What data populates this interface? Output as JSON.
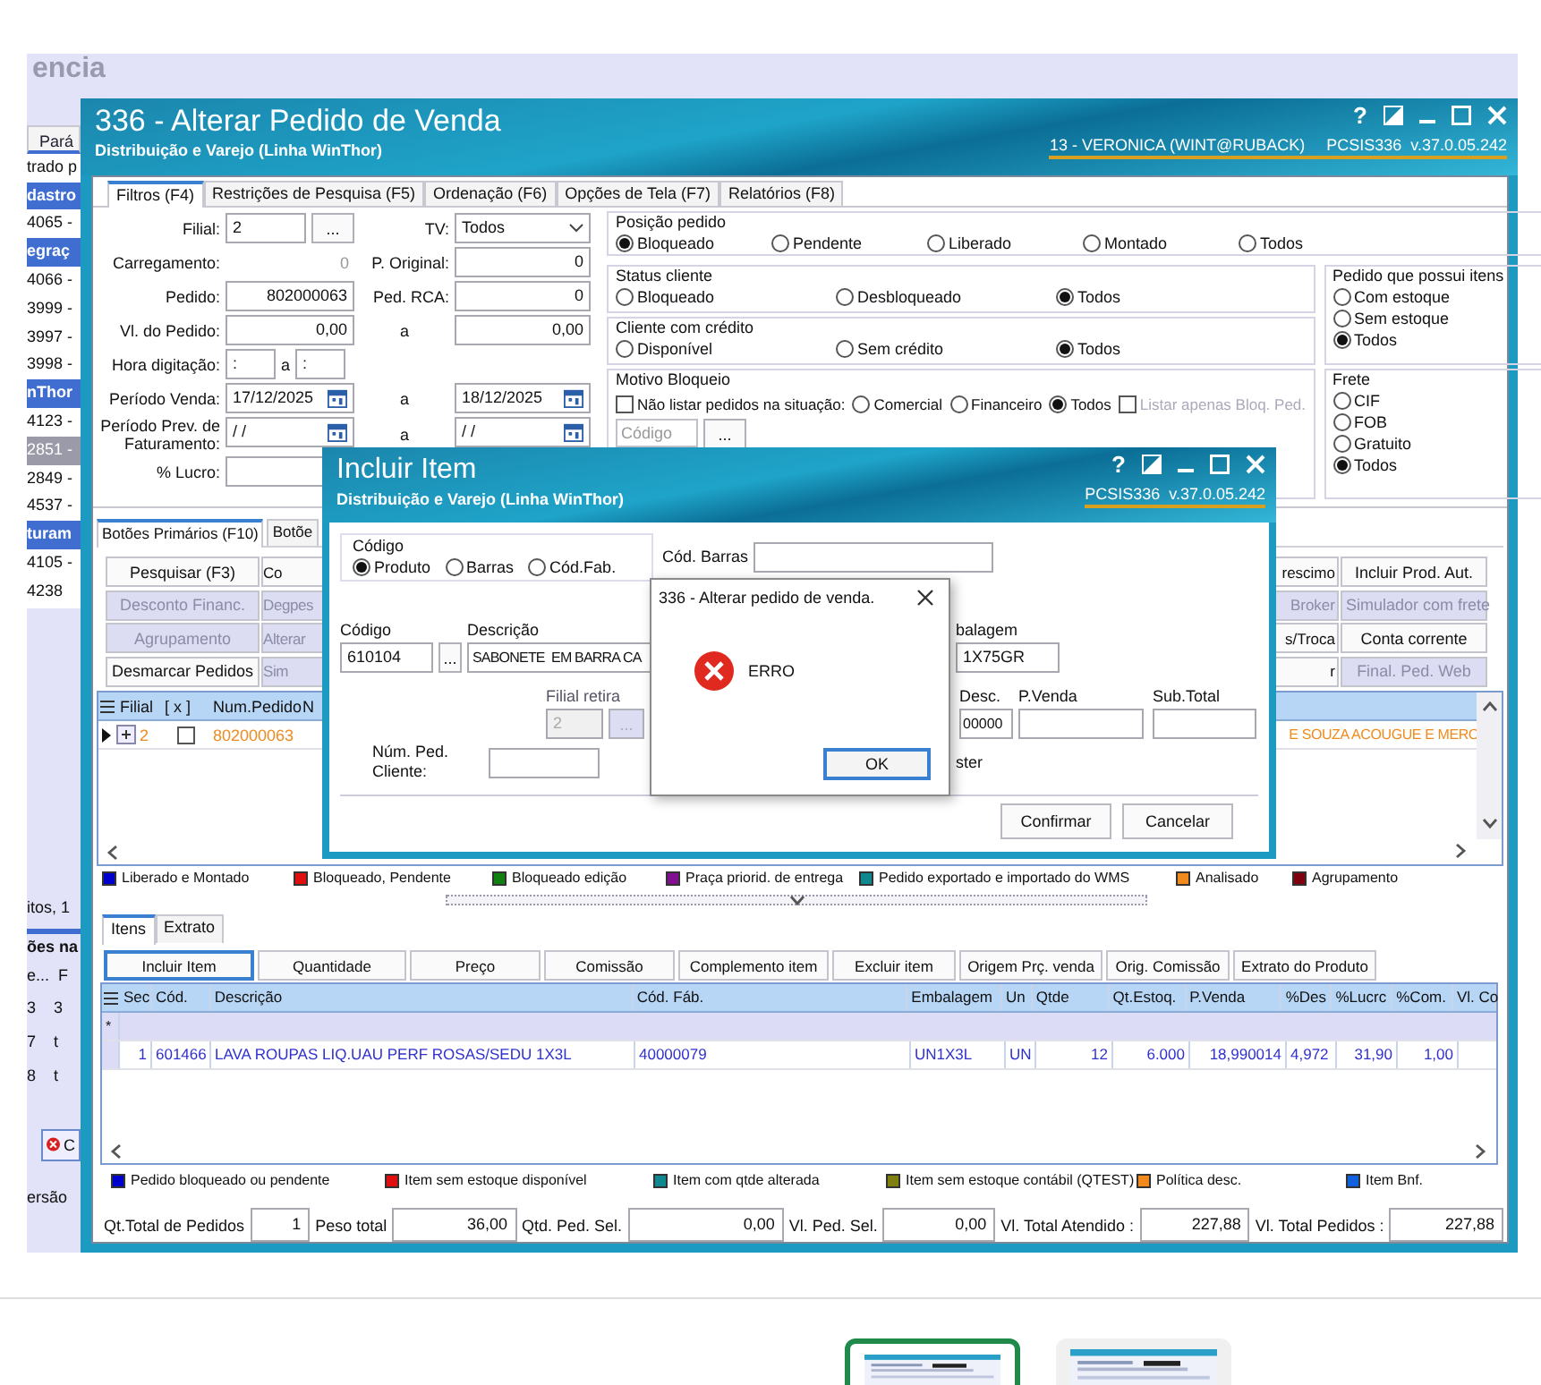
{
  "background_app": {
    "heading": "encia",
    "strip_upper": [
      {
        "text": "Pará",
        "kind": "tab"
      },
      {
        "text": "trado p",
        "kind": "plain"
      },
      {
        "text": "dastro",
        "kind": "section"
      },
      {
        "text": "4065 -",
        "kind": "plain"
      },
      {
        "text": "egraç",
        "kind": "section"
      },
      {
        "text": "4066 -",
        "kind": "plain"
      },
      {
        "text": "3999 -",
        "kind": "plain"
      },
      {
        "text": "3997 -",
        "kind": "plain"
      },
      {
        "text": "3998 -",
        "kind": "plain"
      },
      {
        "text": "nThor",
        "kind": "section"
      },
      {
        "text": "4123 -",
        "kind": "plain"
      },
      {
        "text": "2851 -",
        "kind": "selected"
      },
      {
        "text": "2849 -",
        "kind": "plain"
      },
      {
        "text": "4537 -",
        "kind": "plain"
      },
      {
        "text": "turam",
        "kind": "section"
      },
      {
        "text": "4105 -",
        "kind": "plain"
      },
      {
        "text": "4238",
        "kind": "plain"
      }
    ],
    "strip_lower": [
      {
        "text": "itos, 1",
        "kind": "plain"
      },
      {
        "text": "ões na",
        "kind": "bold"
      },
      {
        "text": "e...  F",
        "kind": "plain"
      },
      {
        "text": "3    3",
        "kind": "plain"
      },
      {
        "text": "7    t",
        "kind": "plain"
      },
      {
        "text": "8    t",
        "kind": "plain"
      },
      {
        "text": "C",
        "kind": "error"
      },
      {
        "text": "ersão",
        "kind": "plain"
      }
    ]
  },
  "main_window": {
    "title": "336 - Alterar Pedido de Venda",
    "subtitle": "Distribuição e Varejo (Linha WinThor)",
    "help_label": "?",
    "user": "13 - VERONICA (WINT@RUBACK)",
    "version": "PCSIS336  v.37.0.05.242",
    "tabs": [
      {
        "label": "Filtros (F4)",
        "selected": true
      },
      {
        "label": "Restrições de Pesquisa (F5)",
        "selected": false
      },
      {
        "label": "Ordenação (F6)",
        "selected": false
      },
      {
        "label": "Opções de Tela (F7)",
        "selected": false
      },
      {
        "label": "Relatórios (F8)",
        "selected": false
      }
    ],
    "form_rows": [
      [
        {
          "kind": "label",
          "text": "Filial:"
        },
        {
          "kind": "lookup",
          "value": "2",
          "lookup_label": "..."
        },
        {
          "kind": "label",
          "text": "TV:"
        },
        {
          "kind": "select",
          "value": "Todos"
        }
      ],
      [
        {
          "kind": "label",
          "text": "Carregamento:"
        },
        {
          "kind": "readout",
          "value": "0"
        },
        {
          "kind": "label",
          "text": "P. Original:"
        },
        {
          "kind": "input",
          "value": "0"
        }
      ],
      [
        {
          "kind": "label",
          "text": "Pedido:"
        },
        {
          "kind": "input",
          "value": "802000063"
        },
        {
          "kind": "label",
          "text": "Ped. RCA:"
        },
        {
          "kind": "input",
          "value": "0"
        }
      ],
      [
        {
          "kind": "label",
          "text": "Vl. do Pedido:"
        },
        {
          "kind": "input",
          "value": "0,00"
        },
        {
          "kind": "connector",
          "text": "a"
        },
        {
          "kind": "input",
          "value": "0,00"
        }
      ],
      [
        {
          "kind": "label",
          "text": "Hora digitação:"
        },
        {
          "kind": "time",
          "from": ":",
          "sep": "a",
          "to": ":"
        }
      ],
      [
        {
          "kind": "label",
          "text": "Período Venda:"
        },
        {
          "kind": "date",
          "value": "17/12/2025"
        },
        {
          "kind": "connector",
          "text": "a"
        },
        {
          "kind": "date",
          "value": "18/12/2025"
        }
      ],
      [
        {
          "kind": "label",
          "text": "Período Prev. de Faturamento:"
        },
        {
          "kind": "date",
          "value": "/ /"
        },
        {
          "kind": "connector",
          "text": "a"
        },
        {
          "kind": "date",
          "value": "/ /"
        }
      ],
      [
        {
          "kind": "label",
          "text": "% Lucro:"
        },
        {
          "kind": "input"
        }
      ]
    ],
    "groups": [
      {
        "title": "Posição pedido",
        "options": [
          {
            "label": "Bloqueado",
            "selected": true
          },
          {
            "label": "Pendente",
            "selected": false
          },
          {
            "label": "Liberado",
            "selected": false
          },
          {
            "label": "Montado",
            "selected": false
          },
          {
            "label": "Todos",
            "selected": false
          }
        ]
      },
      {
        "title": "Status cliente",
        "options": [
          {
            "label": "Bloqueado",
            "selected": false
          },
          {
            "label": "Desbloqueado",
            "selected": false
          },
          {
            "label": "Todos",
            "selected": true
          }
        ]
      },
      {
        "title": "Pedido que possui itens",
        "options": [
          {
            "label": "Com estoque",
            "selected": false
          },
          {
            "label": "Sem estoque",
            "selected": false
          },
          {
            "label": "Todos",
            "selected": true
          }
        ]
      },
      {
        "title": "Cliente com crédito",
        "options": [
          {
            "label": "Disponível",
            "selected": false
          },
          {
            "label": "Sem crédito",
            "selected": false
          },
          {
            "label": "Todos",
            "selected": true
          }
        ]
      },
      {
        "title": "Frete",
        "options": [
          {
            "label": "CIF",
            "selected": false
          },
          {
            "label": "FOB",
            "selected": false
          },
          {
            "label": "Gratuito",
            "selected": false
          },
          {
            "label": "Todos",
            "selected": true
          }
        ]
      }
    ],
    "motivo": {
      "title": "Motivo Bloqueio",
      "checkbox": {
        "label": "Não listar pedidos na situação:",
        "checked": false
      },
      "options": [
        {
          "label": "Comercial",
          "selected": false
        },
        {
          "label": "Financeiro",
          "selected": false
        },
        {
          "label": "Todos",
          "selected": true
        }
      ],
      "secondary_checkbox": {
        "label": "Listar apenas Bloq. Ped.",
        "checked": false,
        "disabled": true
      },
      "code_placeholder": "Código",
      "lookup_label": "..."
    },
    "button_tabs": [
      {
        "label": "Botões Primários (F10)",
        "selected": true
      },
      {
        "label": "Botõe",
        "selected": false
      }
    ],
    "buttons_left": [
      [
        {
          "label": "Pesquisar (F3)",
          "disabled": false
        },
        {
          "label": "Co",
          "disabled": false
        }
      ],
      [
        {
          "label": "Desconto Financ.",
          "disabled": true
        },
        {
          "label": "Degpes",
          "disabled": true
        }
      ],
      [
        {
          "label": "Agrupamento",
          "disabled": true
        },
        {
          "label": "Alterar",
          "disabled": true
        }
      ],
      [
        {
          "label": "Desmarcar Pedidos",
          "disabled": false
        },
        {
          "label": "Sim",
          "disabled": true
        }
      ]
    ],
    "buttons_right": [
      [
        {
          "label": "rescimo",
          "disabled": false
        },
        {
          "label": "Incluir Prod. Aut.",
          "disabled": false
        }
      ],
      [
        {
          "label": "Broker",
          "disabled": true
        },
        {
          "label": "Simulador com frete",
          "disabled": true
        }
      ],
      [
        {
          "label": "s/Troca",
          "disabled": false
        },
        {
          "label": "Conta corrente",
          "disabled": false
        }
      ],
      [
        {
          "label": "r",
          "disabled": false
        },
        {
          "label": "Final. Ped. Web",
          "disabled": true
        }
      ]
    ],
    "orders": {
      "columns": [
        "Filial",
        "[ x ]",
        "Num.Pedido",
        "N"
      ],
      "rows": [
        {
          "filial": "2",
          "checked": false,
          "num_pedido": "802000063",
          "column_5": "E SOUZA ACOUGUE E MERC",
          "color": "#f08a1c"
        }
      ]
    },
    "legend": [
      {
        "label": "Liberado e Montado",
        "color": "#0000cc"
      },
      {
        "label": "Bloqueado, Pendente",
        "color": "#e01010"
      },
      {
        "label": "Bloqueado edição",
        "color": "#108010"
      },
      {
        "label": "Praça priorid. de entrega",
        "color": "#801090"
      },
      {
        "label": "Pedido exportado e importado do WMS",
        "color": "#108890"
      },
      {
        "label": "Analisado",
        "color": "#f08a1c"
      },
      {
        "label": "Agrupamento",
        "color": "#800010"
      }
    ],
    "item_tabs": [
      {
        "label": "Itens",
        "selected": true
      },
      {
        "label": "Extrato",
        "selected": false
      }
    ],
    "item_buttons": [
      "Incluir Item",
      "Quantidade",
      "Preço",
      "Comissão",
      "Complemento item",
      "Excluir item",
      "Origem Prç. venda",
      "Orig. Comissão",
      "Extrato do Produto"
    ],
    "items": {
      "columns": [
        "Sec",
        "Cód.",
        "Descrição",
        "Cód. Fáb.",
        "Embalagem",
        "Un",
        "Qtde",
        "Qt.Estoq.",
        "P.Venda",
        "%Des",
        "%Lucrc",
        "%Com.",
        "Vl. Co"
      ],
      "new_row_marker": "*",
      "rows": [
        {
          "color": "#3030d0",
          "cells": [
            "1",
            "601466",
            "LAVA ROUPAS LIQ.UAU PERF ROSAS/SEDU 1X3L",
            "40000079",
            "UN1X3L",
            "UN",
            "12",
            "6.000",
            "18,990014",
            "4,972",
            "31,90",
            "1,00"
          ]
        }
      ]
    },
    "item_legend": [
      {
        "label": "Pedido bloqueado ou pendente",
        "color": "#0000cc"
      },
      {
        "label": "Item sem estoque disponível",
        "color": "#e01010"
      },
      {
        "label": "Item com qtde alterada",
        "color": "#108890"
      },
      {
        "label": "Item sem estoque contábil (QTEST)",
        "color": "#808010"
      },
      {
        "label": "Política desc.",
        "color": "#f08a1c"
      },
      {
        "label": "Item Bnf.",
        "color": "#1060e0"
      }
    ],
    "totals": [
      {
        "label": "Qt.Total de Pedidos",
        "value": "1"
      },
      {
        "label": "Peso total",
        "value": "36,00"
      },
      {
        "label": "Qtd. Ped. Sel.",
        "value": "0,00"
      },
      {
        "label": "Vl. Ped. Sel.",
        "value": "0,00"
      },
      {
        "label": "Vl. Total Atendido :",
        "value": "227,88"
      },
      {
        "label": "Vl. Total Pedidos :",
        "value": "227,88"
      }
    ]
  },
  "item_dialog": {
    "title": "Incluir Item",
    "subtitle": "Distribuição e Varejo (Linha WinThor)",
    "help_label": "?",
    "version": "PCSIS336  v.37.0.05.242",
    "code_type": {
      "title": "Código",
      "options": [
        {
          "label": "Produto",
          "selected": true
        },
        {
          "label": "Barras",
          "selected": false
        },
        {
          "label": "Cód.Fab.",
          "selected": false
        }
      ]
    },
    "barcode_label": "Cód. Barras",
    "codigo": {
      "label": "Código",
      "value": "610104",
      "lookup_label": "..."
    },
    "descricao": {
      "label": "Descrição",
      "value": "SABONETE  EM BARRA CA"
    },
    "embalagem": {
      "label": "balagem",
      "value": "1X75GR"
    },
    "filial_retira": {
      "label": "Filial retira",
      "value": "2",
      "lookup_label": "...",
      "disabled": true
    },
    "desconto": {
      "label": "Desc.",
      "value": "00000"
    },
    "p_venda_label": "P.Venda",
    "sub_total_label": "Sub.Total",
    "num_ped_label": "Núm. Ped. Cliente:",
    "partial_text": "ster",
    "buttons": [
      "Confirmar",
      "Cancelar"
    ]
  },
  "error_dialog": {
    "title": "336 - Alterar pedido de venda.",
    "message": "ERRO",
    "button": "OK"
  },
  "thumbnails": [
    {
      "kind": "picture",
      "selected": true
    },
    {
      "kind": "picture",
      "selected": false
    }
  ]
}
